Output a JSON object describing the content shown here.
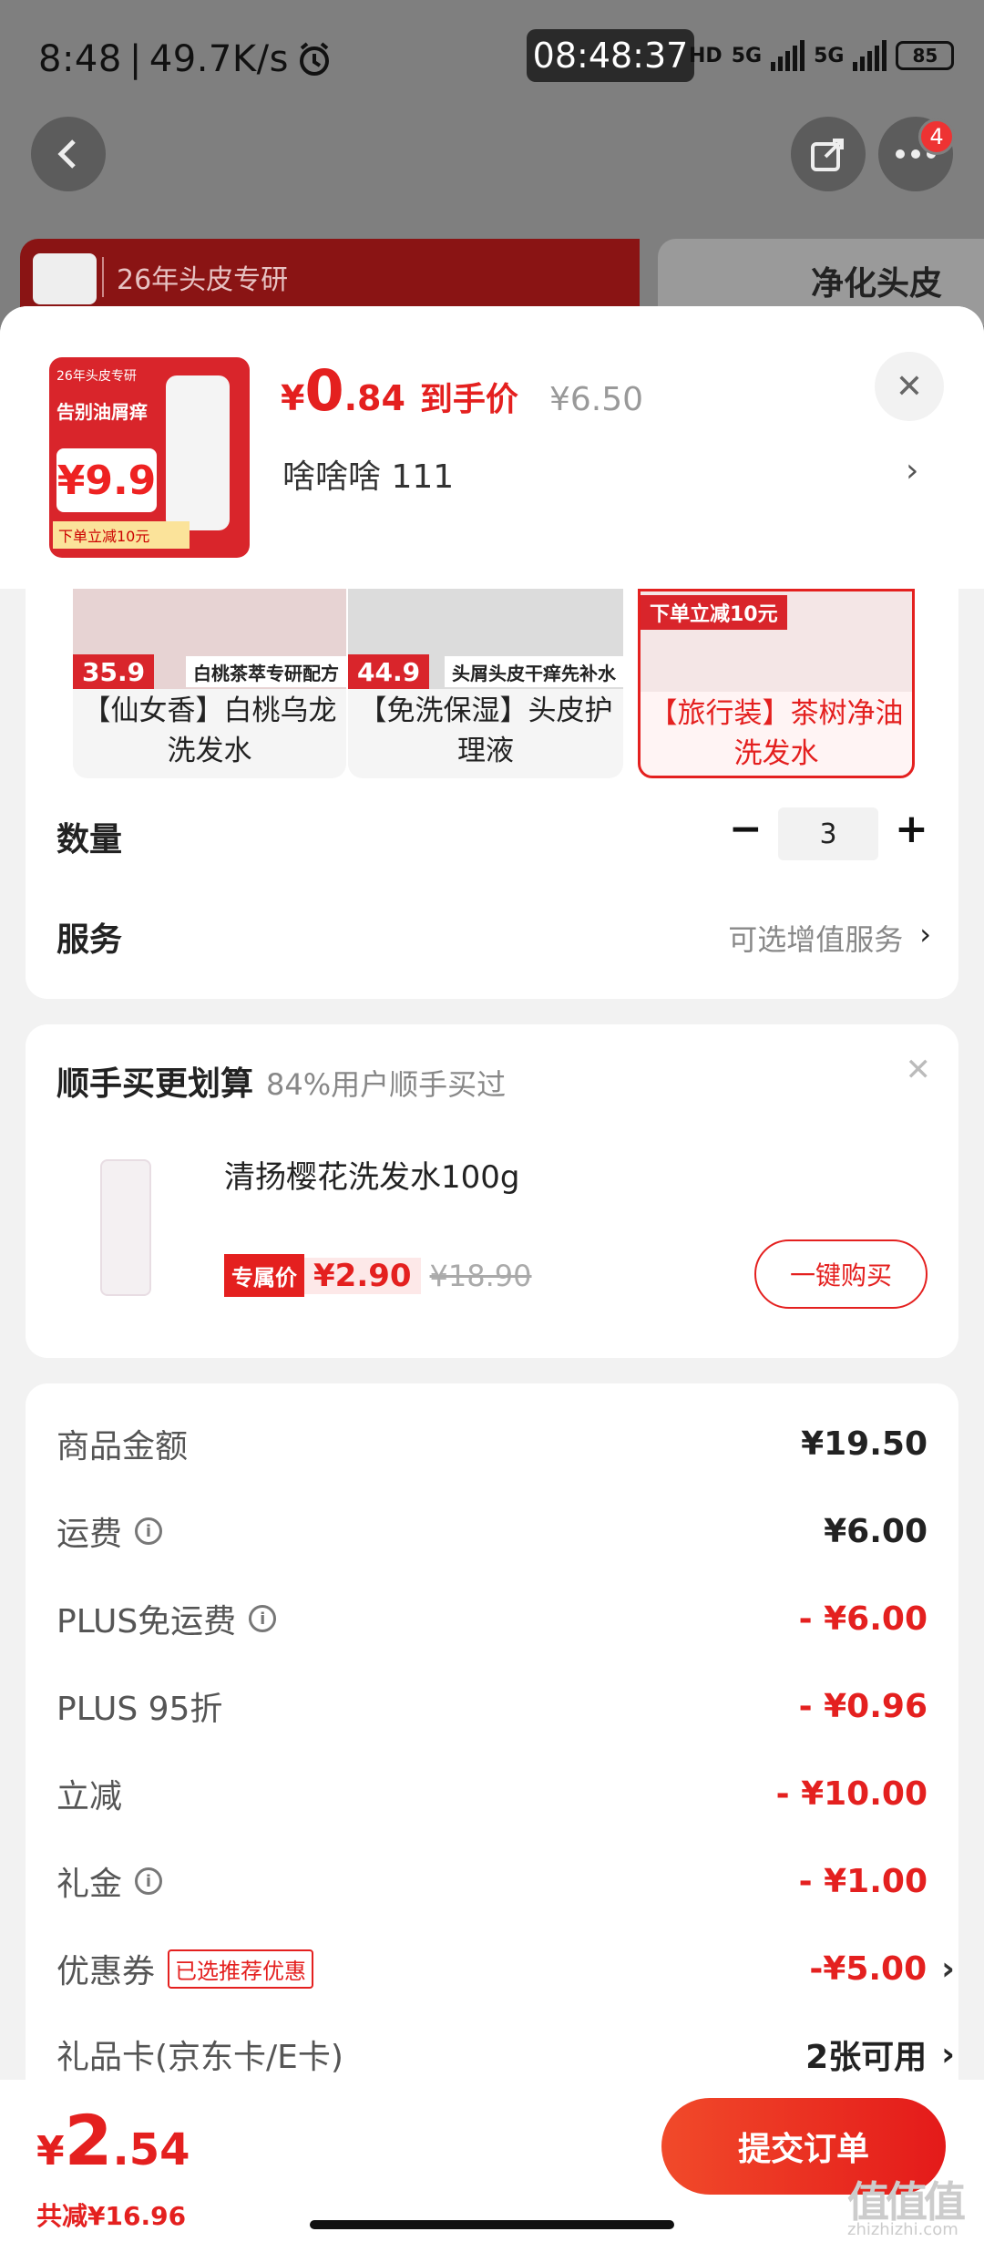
{
  "status_bar": {
    "time": "8:48",
    "speed": "49.7K/s",
    "clock_chip": "08:48:37",
    "hd": "HD",
    "net1": "5G",
    "net2": "5G",
    "battery": "85"
  },
  "background": {
    "banner_left_text": "26年头皮专研",
    "banner_right_text": "净化头皮",
    "notification_count": "4"
  },
  "product": {
    "thumb": {
      "tag_top": "26年头皮专研",
      "tag_main": "告别油屑痒",
      "price": "¥9.9",
      "tag_bottom": "下单立减10元"
    },
    "price_symbol": "¥",
    "price_int": "0",
    "price_dec": ".84",
    "price_label": "到手价",
    "original_price": "¥6.50",
    "spec": "啥啥啥  111"
  },
  "variants": [
    {
      "price_tag": "35.9",
      "desc": "白桃茶萃专研配方",
      "name": "【仙女香】白桃乌龙洗发水"
    },
    {
      "price_tag": "44.9",
      "desc": "头屑头皮干痒先补水",
      "name": "【免洗保湿】头皮护理液"
    },
    {
      "price_tag": "下单立减10元",
      "desc": "",
      "name": "【旅行装】茶树净油洗发水"
    }
  ],
  "quantity": {
    "label": "数量",
    "value": "3",
    "minus": "−",
    "plus": "+"
  },
  "service": {
    "label": "服务",
    "value": "可选增值服务"
  },
  "addon": {
    "title": "顺手买更划算",
    "subtitle": "84%用户顺手买过",
    "product_name": "清扬樱花洗发水100g",
    "price_tag": "专属价",
    "price": "¥2.90",
    "original_price": "¥18.90",
    "buy_button": "一键购买"
  },
  "fees": [
    {
      "label": "商品金额",
      "value": "¥19.50",
      "info": false,
      "red": false
    },
    {
      "label": "运费",
      "value": "¥6.00",
      "info": true,
      "red": false
    },
    {
      "label": "PLUS免运费",
      "value": "- ¥6.00",
      "info": true,
      "red": true
    },
    {
      "label": "PLUS 95折",
      "value": "- ¥0.96",
      "info": false,
      "red": true
    },
    {
      "label": "立减",
      "value": "- ¥10.00",
      "info": false,
      "red": true
    },
    {
      "label": "礼金",
      "value": "- ¥1.00",
      "info": true,
      "red": true
    },
    {
      "label": "优惠券",
      "tag": "已选推荐优惠",
      "value": "-¥5.00",
      "info": false,
      "red": true
    },
    {
      "label": "礼品卡(京东卡/E卡)",
      "value": "2张可用",
      "info": false,
      "red": false
    }
  ],
  "footer": {
    "total_symbol": "¥",
    "total_int": "2",
    "total_dec": ".54",
    "saved": "共减¥16.96",
    "submit": "提交订单"
  },
  "watermark": {
    "main": "值值值",
    "url": "zhizhizhi.com"
  },
  "colors": {
    "accent": "#e4201f",
    "background": "#f2f2f2"
  }
}
